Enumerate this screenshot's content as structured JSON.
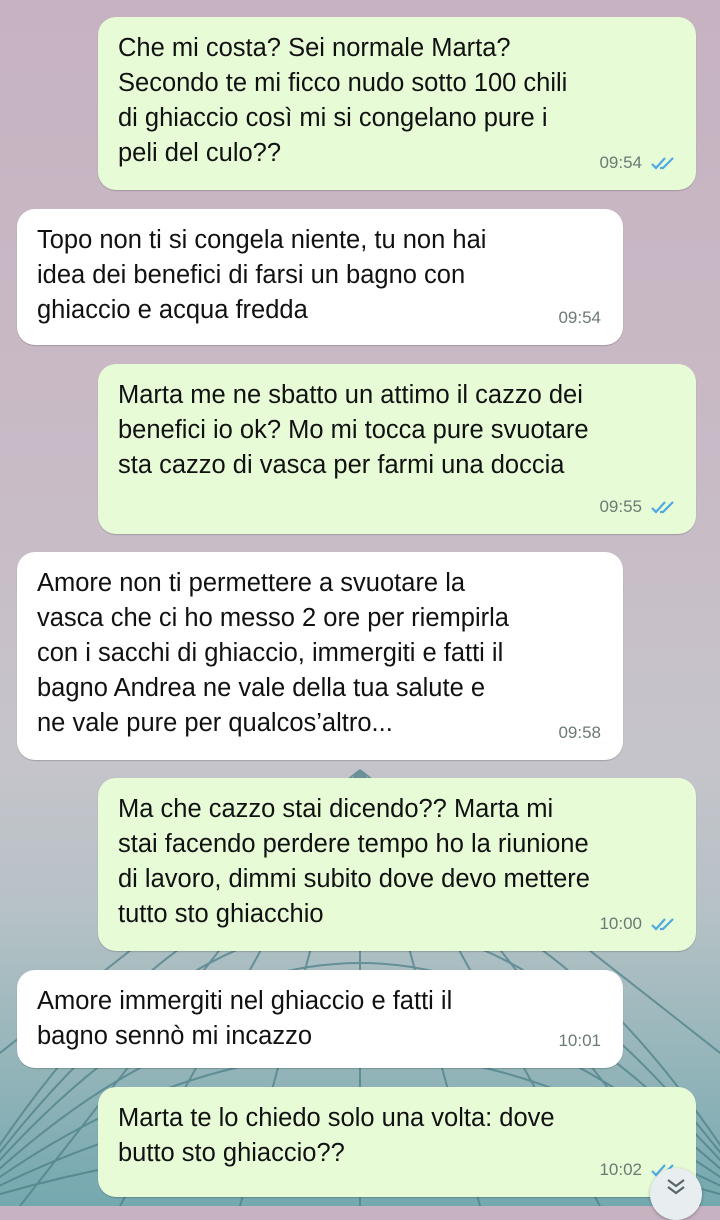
{
  "messages": [
    {
      "dir": "out",
      "text": "Che mi costa? Sei normale Marta?\nSecondo te mi ficco nudo sotto 100 chili\ndi ghiaccio così mi si congelano pure i\npeli del culo??",
      "time": "09:54"
    },
    {
      "dir": "in",
      "text": "Topo non ti si congela niente, tu non hai\nidea dei benefici di farsi un bagno con\nghiaccio e acqua fredda",
      "time": "09:54"
    },
    {
      "dir": "out",
      "text": "Marta me ne sbatto un attimo il cazzo dei\nbenefici io ok? Mo mi tocca pure svuotare\nsta cazzo di vasca per farmi una doccia",
      "time": "09:55"
    },
    {
      "dir": "in",
      "text": "Amore non ti permettere a svuotare la\nvasca che ci ho messo 2 ore per riempirla\ncon i sacchi di ghiaccio, immergiti e fatti il\nbagno Andrea ne vale della tua salute e\nne vale pure per qualcos’altro...",
      "time": "09:58"
    },
    {
      "dir": "out",
      "text": "Ma che cazzo stai dicendo?? Marta mi\nstai facendo perdere tempo ho la riunione\ndi lavoro, dimmi subito dove devo mettere\ntutto sto ghiacchio",
      "time": "10:00"
    },
    {
      "dir": "in",
      "text": "Amore immergiti nel ghiaccio e fatti il\nbagno sennò mi incazzo",
      "time": "10:01"
    },
    {
      "dir": "out",
      "text": "Marta te lo chiedo solo una volta: dove\nbutto sto ghiaccio??",
      "time": "10:02"
    }
  ],
  "colors": {
    "outgoing_bubble": "#e7fbd7",
    "incoming_bubble": "#ffffff",
    "read_ticks": "#4fa9e0"
  },
  "icons": {
    "read_receipt": "double-check-icon",
    "scroll_down": "chevron-double-down-icon"
  }
}
